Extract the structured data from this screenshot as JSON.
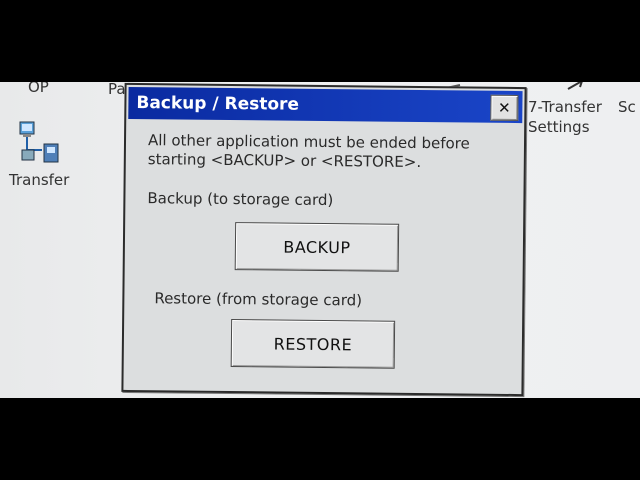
{
  "desktop": {
    "op_label": "OP",
    "pa_label": "Pa",
    "transfer_label": "Transfer",
    "transfer_settings_label_line1": "7-Transfer",
    "transfer_settings_label_line2": "Settings",
    "sc_label": "Sc"
  },
  "dialog": {
    "title": "Backup / Restore",
    "close_symbol": "✕",
    "message_line1": "All other application must be ended before",
    "message_line2": "starting <BACKUP> or <RESTORE>.",
    "backup_label": "Backup (to storage card)",
    "backup_button": "BACKUP",
    "restore_label": "Restore (from storage card)",
    "restore_button": "RESTORE"
  },
  "colors": {
    "titlebar": "#1a45c8",
    "dialog_bg": "#dcdedf",
    "desktop_bg": "#eeeff1"
  }
}
